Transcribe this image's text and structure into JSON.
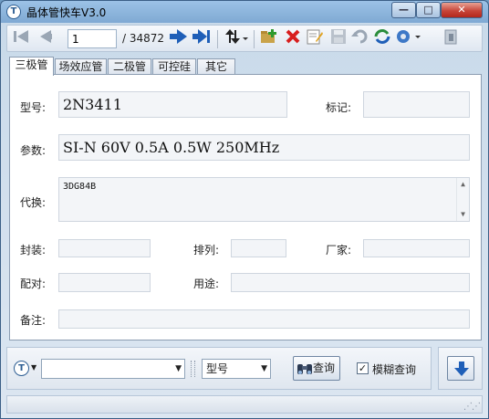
{
  "window": {
    "title": "晶体管快车V3.0"
  },
  "toolbar": {
    "page_current": "1",
    "page_total": "/ 34872",
    "icons": [
      "first-icon",
      "prev-icon",
      "next-icon",
      "last-icon",
      "sort-icon",
      "add-icon",
      "delete-icon",
      "edit-icon",
      "save-icon",
      "undo-icon",
      "refresh-icon",
      "settings-icon",
      "exit-icon"
    ]
  },
  "tabs": [
    "三极管",
    "场效应管",
    "二极管",
    "可控硅",
    "其它"
  ],
  "form": {
    "model_label": "型号:",
    "model_value": "2N3411",
    "mark_label": "标记:",
    "mark_value": "",
    "params_label": "参数:",
    "params_value": "SI-N 60V 0.5A 0.5W 250MHz",
    "substitute_label": "代换:",
    "substitute_value": "3DG84B",
    "package_label": "封装:",
    "package_value": "",
    "pinout_label": "排列:",
    "pinout_value": "",
    "maker_label": "厂家:",
    "maker_value": "",
    "pair_label": "配对:",
    "pair_value": "",
    "usage_label": "用途:",
    "usage_value": "",
    "notes_label": "备注:",
    "notes_value": ""
  },
  "search": {
    "query_value": "",
    "field_selected": "型号",
    "search_label": "查询",
    "fuzzy_label": "模糊查询",
    "fuzzy_checked": "✓"
  },
  "colors": {
    "title_bar": "#8db4dc",
    "close_button": "#c7463a",
    "accent_arrow": "#1f5fb8"
  }
}
